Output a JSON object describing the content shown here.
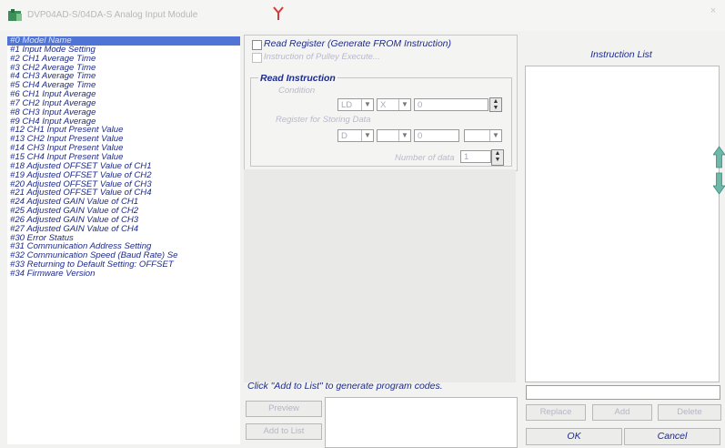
{
  "window": {
    "title": "DVP04AD-S/04DA-S Analog Input Module",
    "close_glyph": "×"
  },
  "item_list": [
    "#0 Model Name",
    "#1 Input Mode Setting",
    "#2 CH1 Average Time",
    "#3 CH2 Average Time",
    "#4 CH3 Average Time",
    "#5 CH4 Average Time",
    "#6 CH1 Input Average",
    "#7 CH2 Input Average",
    "#8 CH3 Input Average",
    "#9 CH4 Input Average",
    "#12 CH1 Input Present Value",
    "#13 CH2 Input Present Value",
    "#14 CH3 Input Present Value",
    "#15 CH4 Input Present Value",
    "#18 Adjusted OFFSET Value of CH1",
    "#19 Adjusted OFFSET Value of CH2",
    "#20 Adjusted OFFSET Value of CH3",
    "#21 Adjusted OFFSET Value of CH4",
    "#24 Adjusted GAIN Value of CH1",
    "#25 Adjusted GAIN Value of CH2",
    "#26 Adjusted GAIN Value of CH3",
    "#27 Adjusted GAIN Value of CH4",
    "#30 Error Status",
    "#31 Communication Address Setting",
    "#32 Communication Speed (Baud Rate) Se",
    "#33 Returning to Default Setting: OFFSET",
    "#34 Firmware Version"
  ],
  "selected_index": 0,
  "read_register": {
    "checkbox_label": "Read Register (Generate FROM Instruction)",
    "pulse_label": "Instruction of Pulley Execute...",
    "group_title": "Read Instruction",
    "condition_label": "Condition",
    "condition_values": [
      "LD",
      "X",
      "0"
    ],
    "register_label": "Register for Storing Data",
    "register_values": [
      "D",
      "",
      "0",
      ""
    ],
    "number_label": "Number of data",
    "number_value": "1"
  },
  "hint": "Click \"Add to List\" to generate program codes.",
  "buttons": {
    "preview": "Preview",
    "add_to_list": "Add to List",
    "replace": "Replace",
    "add": "Add",
    "delete": "Delete",
    "ok": "OK",
    "cancel": "Cancel"
  },
  "instruction_list": {
    "title": "Instruction List"
  },
  "colors": {
    "accent_text": "#1d2b8a",
    "selection": "#4f74d6",
    "arrow_fill": "#6fb7a8",
    "marker_red": "#d23a3a"
  }
}
